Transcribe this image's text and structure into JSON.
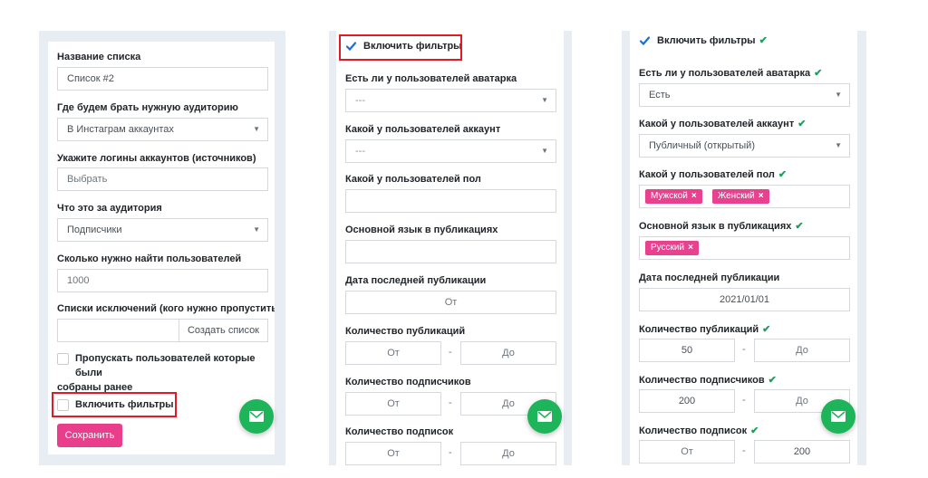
{
  "panel1": {
    "list_name_label": "Название списка",
    "list_name_value": "Список #2",
    "audience_source_label": "Где будем брать нужную аудиторию",
    "audience_source_value": "В Инстаграм аккаунтах",
    "logins_label": "Укажите логины аккаунтов (источников)",
    "logins_placeholder": "Выбрать",
    "audience_type_label": "Что это за аудитория",
    "audience_type_value": "Подписчики",
    "count_label": "Сколько нужно найти пользователей",
    "count_value": "1000",
    "exclusions_label": "Списки исключений (кого нужно пропустить)",
    "create_list_label": "Создать список",
    "skip_line1": "Пропускать пользователей которые были",
    "skip_line2": "собраны ранее",
    "filters_label": "Включить фильтры",
    "save_label": "Сохранить"
  },
  "panel2": {
    "filters_label": "Включить фильтры",
    "avatar_label": "Есть ли у пользователей аватарка",
    "avatar_value": "---",
    "account_label": "Какой у пользователей аккаунт",
    "account_value": "---",
    "gender_label": "Какой у пользователей пол",
    "language_label": "Основной язык в публикациях",
    "last_post_label": "Дата последней публикации",
    "last_post_placeholder": "От",
    "posts_label": "Количество публикаций",
    "followers_label": "Количество подписчиков",
    "following_label": "Количество подписок",
    "from_placeholder": "От",
    "to_placeholder": "До",
    "range_dash": "-"
  },
  "panel3": {
    "filters_label": "Включить фильтры",
    "avatar_label": "Есть ли у пользователей аватарка",
    "avatar_value": "Есть",
    "account_label": "Какой у пользователей аккаунт",
    "account_value": "Публичный (открытый)",
    "gender_label": "Какой у пользователей пол",
    "gender_tags": [
      "Мужской",
      "Женский"
    ],
    "language_label": "Основной язык в публикациях",
    "language_tags": [
      "Русский"
    ],
    "last_post_label": "Дата последней публикации",
    "last_post_value": "2021/01/01",
    "posts_label": "Количество публикаций",
    "posts_from": "50",
    "followers_label": "Количество подписчиков",
    "followers_from": "200",
    "following_label": "Количество подписок",
    "following_to": "200",
    "from_placeholder": "От",
    "to_placeholder": "До",
    "range_dash": "-",
    "tag_remove_glyph": "×"
  },
  "icons": {
    "caret": "▼",
    "check_mark": "✔"
  },
  "colors": {
    "accent_pink": "#e83e8c",
    "fab_green": "#1db45a",
    "check_green": "#1aa05a",
    "highlight_red": "#e01b24",
    "checkbox_blue": "#1c6fd1"
  }
}
